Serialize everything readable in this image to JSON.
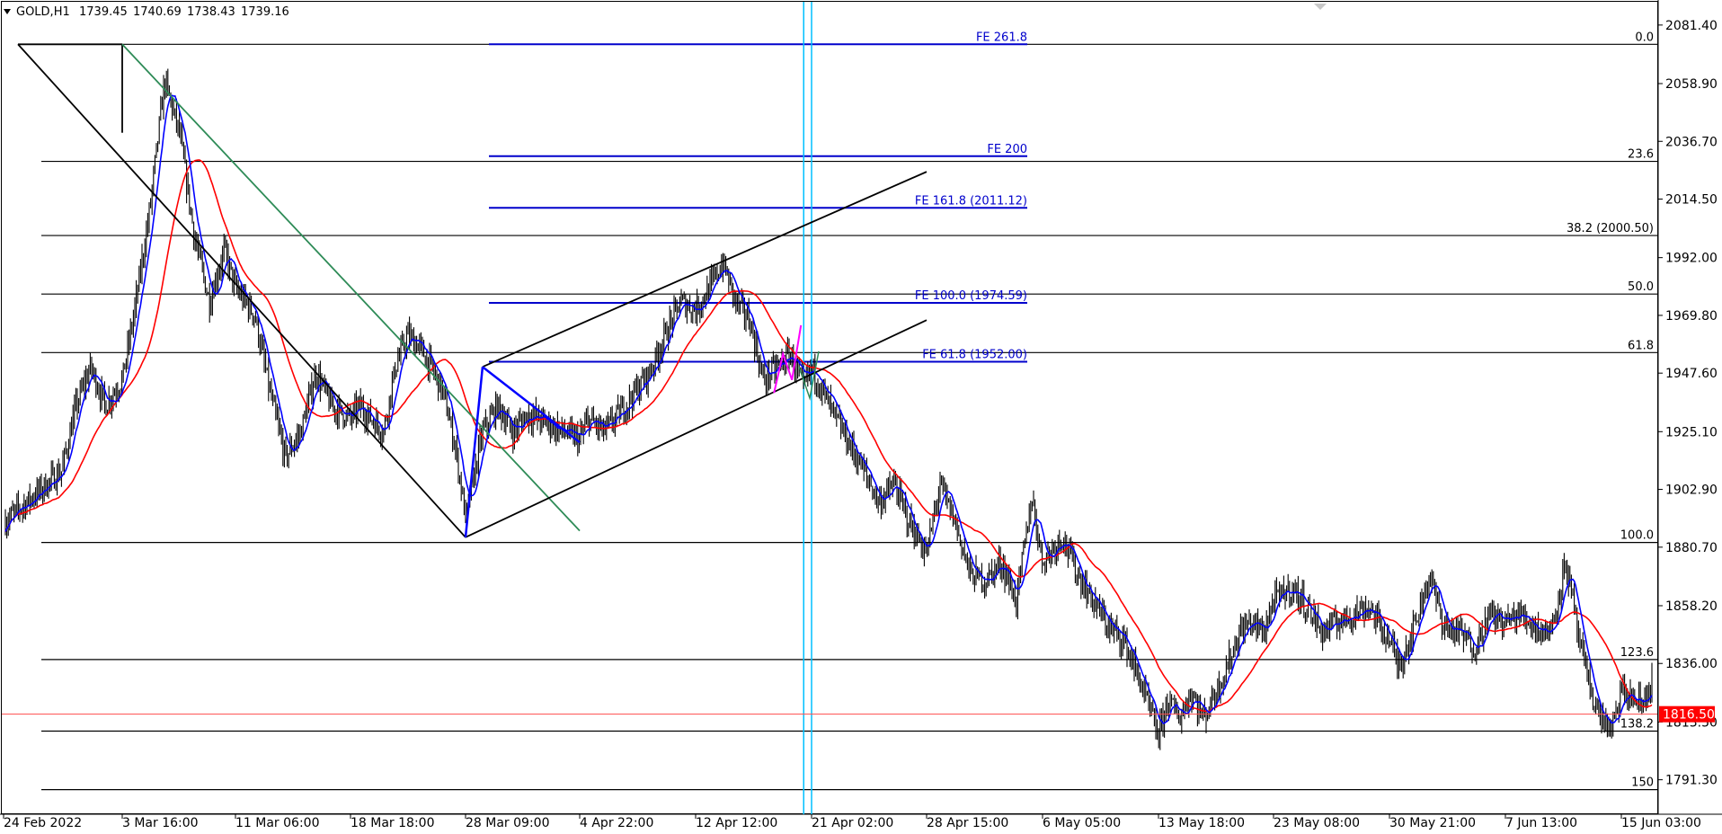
{
  "header": {
    "symbol": "GOLD,H1",
    "open": "1739.45",
    "high": "1740.69",
    "low": "1738.43",
    "close": "1739.16"
  },
  "current_price": {
    "value": 1816.5,
    "label": "1816.50",
    "color": "#ff0000"
  },
  "colors": {
    "candles": "#000000",
    "ma_fast": "#0000ff",
    "ma_slow": "#ff0000",
    "fib_retracement": "#000000",
    "fib_expansion": "#0000cc",
    "vertical_lines": "#00bfff",
    "trendline_green": "#2e8b57",
    "magenta": "#ff00ff",
    "price_line": "#ff4d4d"
  },
  "chart_data": {
    "type": "candlestick",
    "y_axis": {
      "ylim": [
        1781.5,
        2085.5
      ],
      "ticks": [
        2081.4,
        2058.9,
        2036.7,
        2014.5,
        1992.0,
        1969.8,
        1947.6,
        1925.1,
        1902.9,
        1880.7,
        1858.2,
        1836.0,
        1813.5,
        1791.3
      ],
      "labels": [
        "2081.40",
        "2058.90",
        "2036.70",
        "2014.50",
        "1992.00",
        "1969.80",
        "1947.60",
        "1925.10",
        "1902.90",
        "1880.70",
        "1858.20",
        "1836.00",
        "1813.50",
        "1791.30"
      ]
    },
    "x_axis": {
      "labels": [
        "24 Feb 2022",
        "3 Mar 16:00",
        "11 Mar 06:00",
        "18 Mar 18:00",
        "28 Mar 09:00",
        "4 Apr 22:00",
        "12 Apr 12:00",
        "21 Apr 02:00",
        "28 Apr 15:00",
        "6 May 05:00",
        "13 May 18:00",
        "23 May 08:00",
        "30 May 21:00",
        "7 Jun 13:00",
        "15 Jun 03:00"
      ]
    },
    "price_path": [
      [
        "24 Feb 2022",
        1895
      ],
      [
        "26 Feb",
        1905
      ],
      [
        "27 Feb",
        1910
      ],
      [
        "28 Feb",
        1935
      ],
      [
        "1 Mar",
        1950
      ],
      [
        "2 Mar",
        1935
      ],
      [
        "3 Mar 16:00",
        1945
      ],
      [
        "4 Mar",
        1972
      ],
      [
        "5 Mar",
        2010
      ],
      [
        "6 Mar",
        2060
      ],
      [
        "7 Mar",
        2040
      ],
      [
        "8 Mar",
        2000
      ],
      [
        "9 Mar",
        1975
      ],
      [
        "10 Mar",
        1995
      ],
      [
        "11 Mar 06:00",
        1980
      ],
      [
        "12 Mar",
        1970
      ],
      [
        "13 Mar",
        1940
      ],
      [
        "14 Mar",
        1915
      ],
      [
        "15 Mar",
        1925
      ],
      [
        "16 Mar",
        1948
      ],
      [
        "17 Mar",
        1935
      ],
      [
        "18 Mar 18:00",
        1930
      ],
      [
        "19 Mar",
        1935
      ],
      [
        "20 Mar",
        1930
      ],
      [
        "21 Mar",
        1925
      ],
      [
        "22 Mar",
        1950
      ],
      [
        "23 Mar",
        1962
      ],
      [
        "24 Mar",
        1958
      ],
      [
        "25 Mar",
        1950
      ],
      [
        "26 Mar",
        1940
      ],
      [
        "27 Mar",
        1920
      ],
      [
        "28 Mar 09:00",
        1892
      ],
      [
        "29 Mar",
        1925
      ],
      [
        "30 Mar",
        1935
      ],
      [
        "31 Mar",
        1925
      ],
      [
        "1 Apr",
        1932
      ],
      [
        "3 Apr",
        1926
      ],
      [
        "4 Apr 22:00",
        1922
      ],
      [
        "5 Apr",
        1930
      ],
      [
        "6 Apr",
        1925
      ],
      [
        "7 Apr",
        1932
      ],
      [
        "8 Apr",
        1940
      ],
      [
        "9 Apr",
        1948
      ],
      [
        "10 Apr",
        1962
      ],
      [
        "11 Apr",
        1975
      ],
      [
        "12 Apr 12:00",
        1972
      ],
      [
        "13 Apr",
        1980
      ],
      [
        "14 Apr",
        1990
      ],
      [
        "15 Apr",
        1975
      ],
      [
        "16 Apr",
        1968
      ],
      [
        "17 Apr",
        1945
      ],
      [
        "18 Apr",
        1950
      ],
      [
        "19 Apr",
        1955
      ],
      [
        "20 Apr",
        1942
      ],
      [
        "21 Apr 02:00",
        1950
      ],
      [
        "22 Apr",
        1932
      ],
      [
        "24 Apr",
        1910
      ],
      [
        "25 Apr",
        1898
      ],
      [
        "26 Apr",
        1905
      ],
      [
        "27 Apr",
        1890
      ],
      [
        "28 Apr 15:00",
        1878
      ],
      [
        "29 Apr",
        1905
      ],
      [
        "30 Apr",
        1890
      ],
      [
        "1 May",
        1870
      ],
      [
        "2 May",
        1868
      ],
      [
        "3 May",
        1875
      ],
      [
        "4 May",
        1860
      ],
      [
        "5 May",
        1900
      ],
      [
        "6 May 05:00",
        1875
      ],
      [
        "7 May",
        1885
      ],
      [
        "8 May",
        1870
      ],
      [
        "9 May",
        1860
      ],
      [
        "10 May",
        1850
      ],
      [
        "11 May",
        1845
      ],
      [
        "12 May",
        1830
      ],
      [
        "13 May 18:00",
        1808
      ],
      [
        "14 May",
        1822
      ],
      [
        "15 May",
        1815
      ],
      [
        "16 May",
        1825
      ],
      [
        "17 May",
        1815
      ],
      [
        "19 May",
        1835
      ],
      [
        "20 May",
        1848
      ],
      [
        "21 May",
        1852
      ],
      [
        "22 May",
        1848
      ],
      [
        "23 May 08:00",
        1860
      ],
      [
        "24 May",
        1865
      ],
      [
        "25 May",
        1858
      ],
      [
        "26 May",
        1848
      ],
      [
        "27 May",
        1852
      ],
      [
        "28 May",
        1855
      ],
      [
        "29 May",
        1858
      ],
      [
        "30 May 21:00",
        1845
      ],
      [
        "31 May",
        1835
      ],
      [
        "1 Jun",
        1850
      ],
      [
        "2 Jun",
        1870
      ],
      [
        "3 Jun",
        1850
      ],
      [
        "4 Jun",
        1848
      ],
      [
        "5 Jun",
        1842
      ],
      [
        "6 Jun",
        1855
      ],
      [
        "7 Jun 13:00",
        1852
      ],
      [
        "8 Jun",
        1855
      ],
      [
        "9 Jun",
        1850
      ],
      [
        "10 Jun",
        1848
      ],
      [
        "11 Jun",
        1875
      ],
      [
        "12 Jun",
        1840
      ],
      [
        "13 Jun",
        1818
      ],
      [
        "14 Jun",
        1810
      ],
      [
        "15 Jun 03:00",
        1825
      ],
      [
        "16 Jun",
        1820
      ],
      [
        "17 Jun",
        1835
      ]
    ],
    "fib_retracement": [
      {
        "label": "0.0",
        "price": 2074.0
      },
      {
        "label": "23.6",
        "price": 2029.0
      },
      {
        "label": "38.2  (2000.50)",
        "price": 2000.5
      },
      {
        "label": "50.0",
        "price": 1978.0
      },
      {
        "label": "61.8",
        "price": 1955.5
      },
      {
        "label": "100.0",
        "price": 1882.5
      },
      {
        "label": "123.6",
        "price": 1837.5
      },
      {
        "label": "138.2",
        "price": 1810.0
      },
      {
        "label": "150",
        "price": 1787.5
      }
    ],
    "fib_expansion": [
      {
        "label": "FE 261.8",
        "price": 2074.0
      },
      {
        "label": "FE 200",
        "price": 2031.0
      },
      {
        "label": "FE 161.8  (2011.12)",
        "price": 2011.12
      },
      {
        "label": "FE 100.0  (1974.59)",
        "price": 1974.59
      },
      {
        "label": "FE 61.8  (1952.00)",
        "price": 1952.0
      }
    ],
    "trendlines": [
      {
        "name": "black-descending",
        "from": [
          "24 Feb 2022",
          2074
        ],
        "to": [
          "28 Mar 09:00",
          1884.5
        ]
      },
      {
        "name": "black-top-connector",
        "from": [
          "24 Feb 2022",
          2074
        ],
        "to": [
          "3 Mar 16:00",
          2074
        ]
      },
      {
        "name": "black-spike",
        "from": [
          "3 Mar 16:00",
          2074
        ],
        "to": [
          "3 Mar 16:00",
          2040
        ]
      },
      {
        "name": "green-descending",
        "from": [
          "3 Mar 16:00",
          2074
        ],
        "to": [
          "4 Apr 22:00",
          1887
        ]
      },
      {
        "name": "channel-upper",
        "from": [
          "29 Mar",
          1950
        ],
        "to": [
          "28 Apr 15:00",
          2025
        ]
      },
      {
        "name": "channel-lower",
        "from": [
          "28 Mar 09:00",
          1884.5
        ],
        "to": [
          "28 Apr 15:00",
          1968
        ]
      },
      {
        "name": "blue-leg-1",
        "from": [
          "28 Mar 09:00",
          1884.5
        ],
        "to": [
          "29 Mar",
          1950
        ]
      },
      {
        "name": "blue-leg-2",
        "from": [
          "29 Mar",
          1950
        ],
        "to": [
          "4 Apr 22:00",
          1921
        ]
      }
    ],
    "vertical_lines": [
      "20 Apr",
      "21 Apr 02:00"
    ]
  }
}
